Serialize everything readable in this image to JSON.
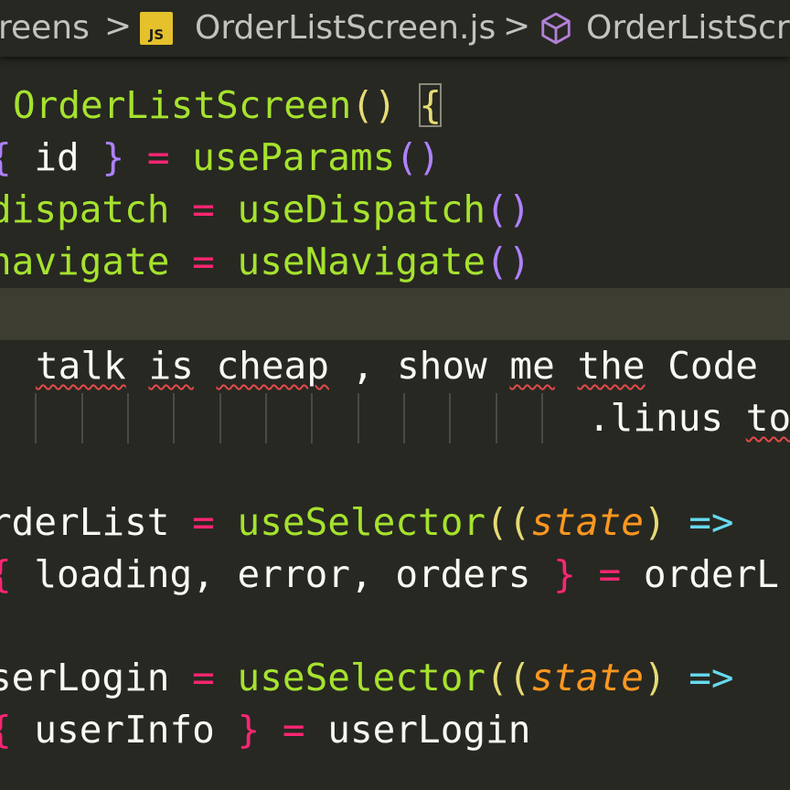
{
  "breadcrumb": {
    "seg1": "reens",
    "sep": ">",
    "file_badge": "JS",
    "seg2": "OrderListScreen.js",
    "seg3": "OrderListScr"
  },
  "code": {
    "l1": {
      "name": "OrderListScreen",
      "open": "(",
      "close": ")",
      "brace": "{"
    },
    "l2": {
      "ob": "{",
      "id": " id ",
      "cb": "}",
      "eq": "=",
      "fn": "useParams",
      "op": "(",
      "cp": ")"
    },
    "l3": {
      "name": "dispatch",
      "eq": "=",
      "fn": "useDispatch",
      "op": "(",
      "cp": ")"
    },
    "l4": {
      "name": "navigate",
      "eq": "=",
      "fn": "useNavigate",
      "op": "(",
      "cp": ")"
    },
    "l6": {
      "w1": "talk",
      "w2": "is",
      "w3": "cheap",
      "rest1": " , show ",
      "w4": "me",
      "w5": "the",
      "rest2": " Code"
    },
    "l7": {
      "pre": ".linus ",
      "w": "to"
    },
    "l8": {
      "name": "rderList",
      "eq": "=",
      "fn": "useSelector",
      "op": "((",
      "param": "state",
      "cp": ")",
      "arrow": "=>"
    },
    "l9": {
      "ob": "{",
      "vars": " loading, error, orders ",
      "cb": "}",
      "eq": "=",
      "rhs": "orderL"
    },
    "l10": {
      "name": "serLogin",
      "eq": "=",
      "fn": "useSelector",
      "op": "((",
      "param": "state",
      "cp": ")",
      "arrow": "=>"
    },
    "l11": {
      "ob": "{",
      "vars": " userInfo ",
      "cb": "}",
      "eq": "=",
      "rhs": "userLogin"
    }
  },
  "colors": {
    "background": "#272822",
    "keyword_pink": "#f92672",
    "function_green": "#a6e22e",
    "paren_yellow": "#e6db74",
    "param_orange": "#fd971f",
    "arrow_cyan": "#66d9ef",
    "brace_purple": "#ae81ff",
    "error_squiggle": "#e24a4a"
  }
}
